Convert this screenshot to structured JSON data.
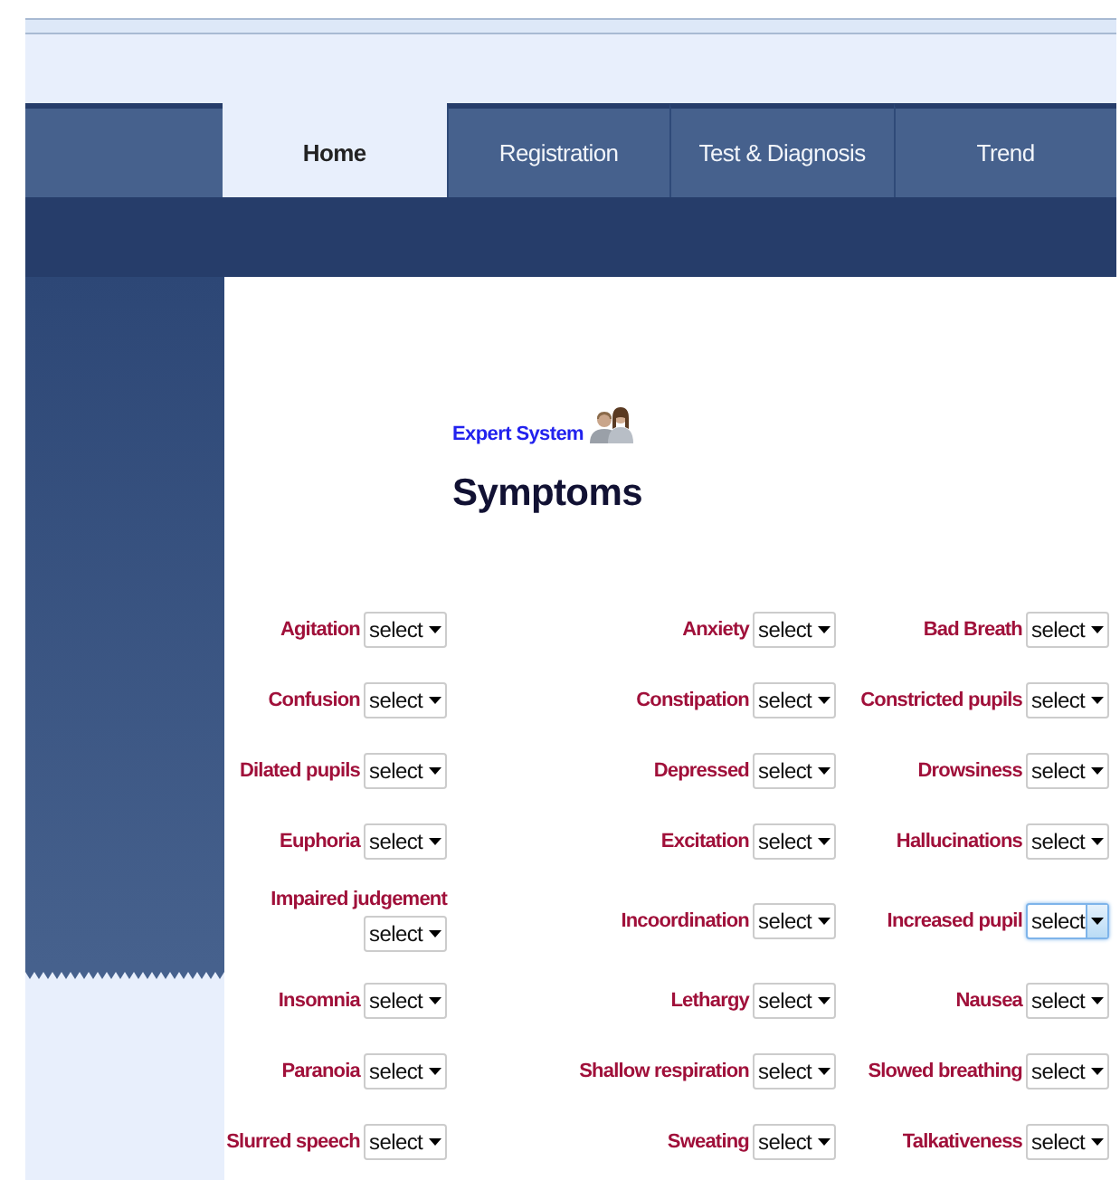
{
  "tabs": [
    {
      "label": "Home",
      "selected": true
    },
    {
      "label": "Registration",
      "selected": false
    },
    {
      "label": "Test & Diagnosis",
      "selected": false
    },
    {
      "label": "Trend",
      "selected": false
    }
  ],
  "expert_link": "Expert System",
  "heading": "Symptoms",
  "symptoms": [
    {
      "label": "Agitation",
      "value": "select",
      "focused": false
    },
    {
      "label": "Anxiety",
      "value": "select",
      "focused": false
    },
    {
      "label": "Bad Breath",
      "value": "select",
      "focused": false
    },
    {
      "label": "Confusion",
      "value": "select",
      "focused": false
    },
    {
      "label": "Constipation",
      "value": "select",
      "focused": false
    },
    {
      "label": "Constricted pupils",
      "value": "select",
      "focused": false
    },
    {
      "label": "Dilated pupils",
      "value": "select",
      "focused": false
    },
    {
      "label": "Depressed",
      "value": "select",
      "focused": false
    },
    {
      "label": "Drowsiness",
      "value": "select",
      "focused": false
    },
    {
      "label": "Euphoria",
      "value": "select",
      "focused": false
    },
    {
      "label": "Excitation",
      "value": "select",
      "focused": false
    },
    {
      "label": "Hallucinations",
      "value": "select",
      "focused": false
    },
    {
      "label": "Impaired judgement",
      "value": "select",
      "focused": false
    },
    {
      "label": "Incoordination",
      "value": "select",
      "focused": false
    },
    {
      "label": "Increased pupil",
      "value": "select",
      "focused": true
    },
    {
      "label": "Insomnia",
      "value": "select",
      "focused": false
    },
    {
      "label": "Lethargy",
      "value": "select",
      "focused": false
    },
    {
      "label": "Nausea",
      "value": "select",
      "focused": false
    },
    {
      "label": "Paranoia",
      "value": "select",
      "focused": false
    },
    {
      "label": "Shallow respiration",
      "value": "select",
      "focused": false
    },
    {
      "label": "Slowed breathing",
      "value": "select",
      "focused": false
    },
    {
      "label": "Slurred speech",
      "value": "select",
      "focused": false
    },
    {
      "label": "Sweating",
      "value": "select",
      "focused": false
    },
    {
      "label": "Talkativeness",
      "value": "select",
      "focused": false
    }
  ]
}
